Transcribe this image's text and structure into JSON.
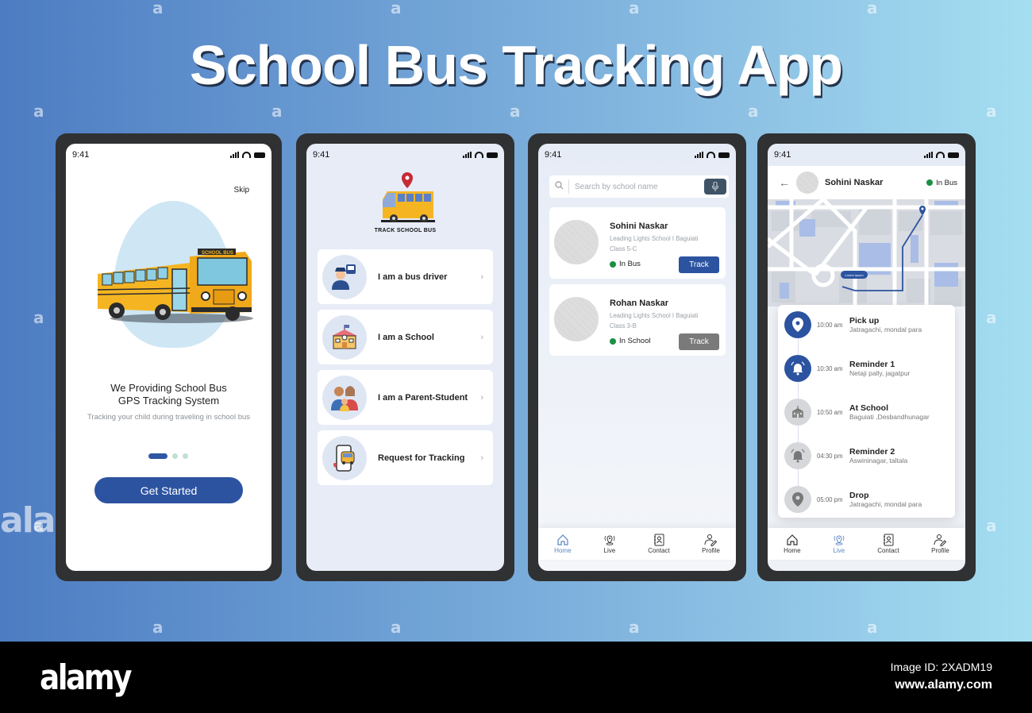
{
  "banner": {
    "title": "School Bus Tracking App",
    "watermark_glyph": "a",
    "watermark_word": "alamy"
  },
  "status_bar": {
    "time": "9:41"
  },
  "onboarding": {
    "skip_label": "Skip",
    "bus_sign": "SCHOOL BUS",
    "headline_line1": "We Providing School Bus",
    "headline_line2": "GPS Tracking System",
    "subtitle": "Tracking your child during traveling in school bus",
    "pager": {
      "total": 3,
      "active": 1
    },
    "cta_label": "Get Started",
    "accent": "#2c53a0"
  },
  "role_select": {
    "logo_text": "TRACK SCHOOL BUS",
    "options": [
      {
        "label": "I am a bus driver",
        "icon": "bus-driver-icon"
      },
      {
        "label": "I am a School",
        "icon": "school-building-icon"
      },
      {
        "label": "I am a Parent-Student",
        "icon": "family-icon"
      },
      {
        "label": "Request for Tracking",
        "icon": "phone-bus-tracking-icon"
      }
    ],
    "chevron": "›"
  },
  "student_list": {
    "search_placeholder": "Search by school name",
    "students": [
      {
        "name": "Sohini Naskar",
        "school": "Leading Lights School I Baguiati",
        "class": "Class 5-C",
        "status": "In Bus",
        "track_label": "Track",
        "track_color": "#2c53a0"
      },
      {
        "name": "Rohan Naskar",
        "school": "Leading Lights School I Baguiati",
        "class": "Class 3-B",
        "status": "In School",
        "track_label": "Track",
        "track_color": "#7a7a7a"
      }
    ],
    "status_color": "#1c8f45"
  },
  "live_tracking": {
    "back": "←",
    "name": "Sohini Naskar",
    "status": "In Bus",
    "map_bubble": "Lorem ipsum",
    "events": [
      {
        "time": "10:00 am",
        "title": "Pick up",
        "address": "Jatragachi, mondal para",
        "icon": "map-pin-icon",
        "done": true
      },
      {
        "time": "10:30 am",
        "title": "Reminder 1",
        "address": "Netaji pally, jagatpur",
        "icon": "bell-icon",
        "done": true
      },
      {
        "time": "10:50 am",
        "title": "At School",
        "address": "Baguiati ,Desbandhunagar",
        "icon": "school-icon",
        "done": false
      },
      {
        "time": "04:30 pm",
        "title": "Reminder 2",
        "address": "Aswininagar, taltala",
        "icon": "bell-icon",
        "done": false
      },
      {
        "time": "05:00 pm",
        "title": "Drop",
        "address": "Jatragachi, mondal para",
        "icon": "map-pin-icon",
        "done": false
      }
    ]
  },
  "bottom_nav": {
    "items": [
      {
        "label": "Home",
        "icon": "home-icon"
      },
      {
        "label": "Live",
        "icon": "live-location-icon"
      },
      {
        "label": "Contact",
        "icon": "contact-book-icon"
      },
      {
        "label": "Profile",
        "icon": "profile-edit-icon"
      }
    ],
    "active_color": "#5a85c3"
  },
  "footer": {
    "brand": "alamy",
    "image_id": "Image ID: 2XADM19",
    "site": "www.alamy.com"
  }
}
